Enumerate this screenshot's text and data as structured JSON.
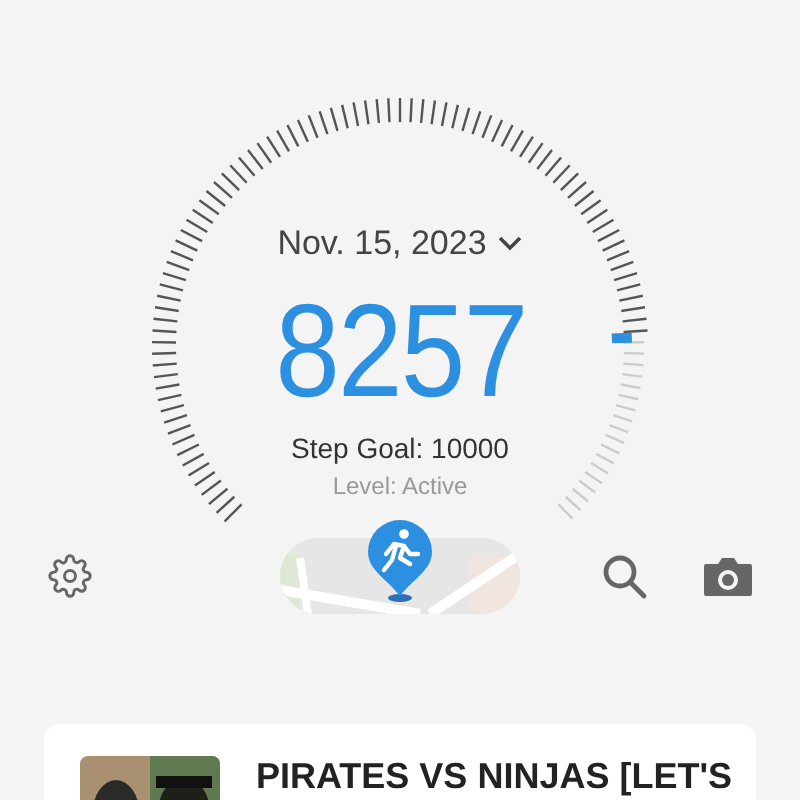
{
  "date": "Nov. 15, 2023",
  "steps": "8257",
  "goal": "Step Goal: 10000",
  "activity": "Level: Active",
  "card": {
    "title": "PIRATES VS NINJAS [LET'S"
  }
}
